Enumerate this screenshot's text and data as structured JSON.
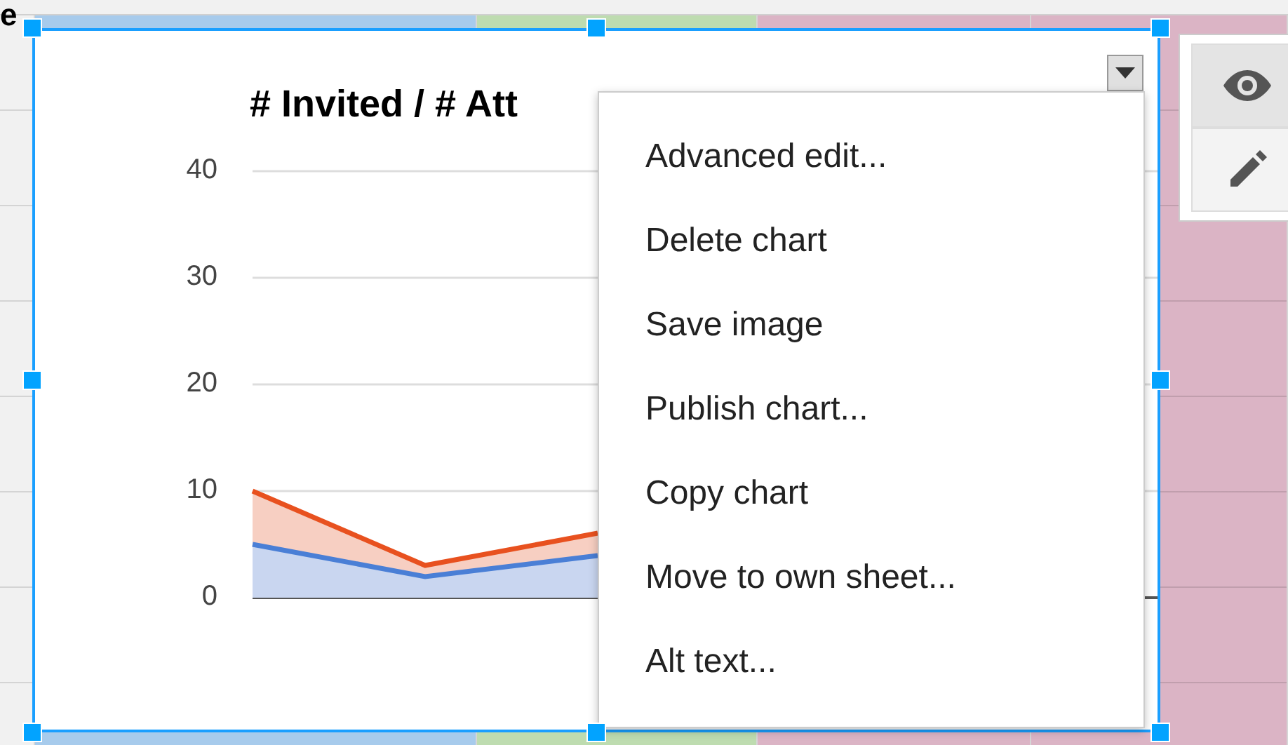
{
  "cell_fragment": "e",
  "chart": {
    "title": "# Invited / # Att",
    "y_axis_labels": [
      "40",
      "30",
      "20",
      "10",
      "0"
    ]
  },
  "chart_menu": {
    "items": [
      "Advanced edit...",
      "Delete chart",
      "Save image",
      "Publish chart...",
      "Copy chart",
      "Move to own sheet...",
      "Alt text..."
    ]
  },
  "side_buttons": [
    {
      "kind": "view",
      "selected": true
    },
    {
      "kind": "edit",
      "selected": false
    }
  ]
}
